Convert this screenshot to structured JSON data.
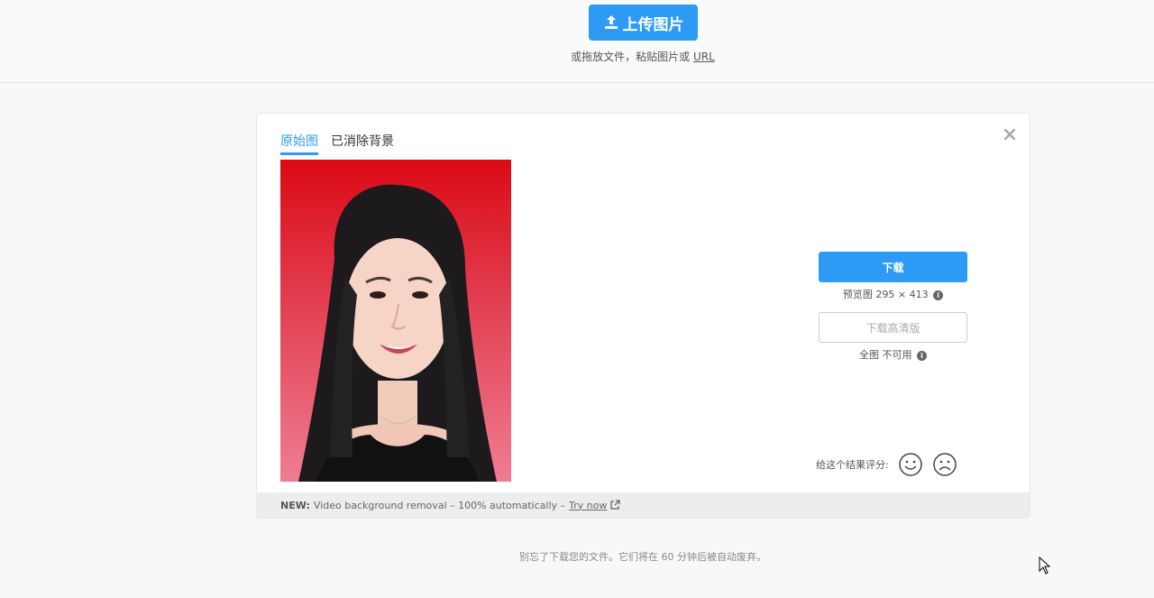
{
  "upload": {
    "button_label": "上传图片",
    "hint_prefix": "或拖放文件，粘贴图片或",
    "hint_link": "URL"
  },
  "tabs": [
    {
      "label": "原始图",
      "active": true
    },
    {
      "label": "已消除背景",
      "active": false
    }
  ],
  "close_icon": "×",
  "actions": {
    "download_label": "下载",
    "preview_info": "预览图 295 × 413",
    "hd_label": "下载高清版",
    "full_info": "全图 不可用"
  },
  "rating": {
    "label": "给这个结果评分:"
  },
  "footer": {
    "new_label": "NEW:",
    "text": "Video background removal – 100% automatically –",
    "link": "Try now"
  },
  "bottom_note": "别忘了下载您的文件。它们将在 60 分钟后被自动废弃。",
  "colors": {
    "accent": "#2d9bf5",
    "photo_bg_top": "#db0a15",
    "photo_bg_bottom": "#ef7d92"
  }
}
